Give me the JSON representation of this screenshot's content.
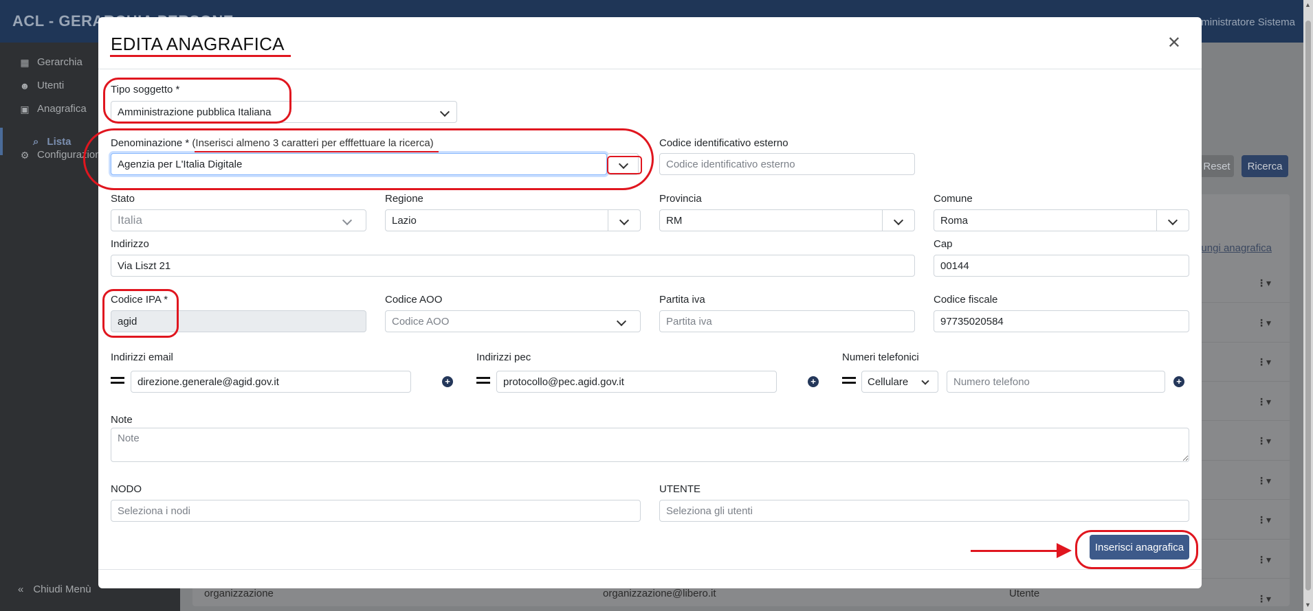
{
  "app": {
    "title": "ACL - GERARCHIA PERSONE",
    "user": "Amministratore Sistema"
  },
  "sidebar": {
    "items": [
      {
        "label": "Gerarchia",
        "icon": "sitemap-icon"
      },
      {
        "label": "Utenti",
        "icon": "users-icon"
      },
      {
        "label": "Anagrafica",
        "icon": "id-card-icon"
      },
      {
        "label": "Configurazioni",
        "icon": "gear-icon"
      }
    ],
    "sub_item": "Lista",
    "collapse": "Chiudi Menù"
  },
  "background": {
    "reset": "Reset",
    "ricerca": "Ricerca",
    "add_link": "Aggiungi anagrafica",
    "last_row": {
      "name": "organizzazione",
      "email": "organizzazione@libero.it",
      "role": "Utente"
    }
  },
  "modal": {
    "title": "EDITA ANAGRAFICA",
    "tipo_soggetto": {
      "label": "Tipo soggetto *",
      "value": "Amministrazione pubblica Italiana"
    },
    "denominazione": {
      "label": "Denominazione * ",
      "hint": "(Inserisci almeno 3 caratteri per efffettuare la ricerca)",
      "value": "Agenzia per L'Italia Digitale"
    },
    "codice_esterno": {
      "label": "Codice identificativo esterno",
      "placeholder": "Codice identificativo esterno"
    },
    "stato": {
      "label": "Stato",
      "value": "Italia"
    },
    "regione": {
      "label": "Regione",
      "value": "Lazio"
    },
    "provincia": {
      "label": "Provincia",
      "value": "RM"
    },
    "comune": {
      "label": "Comune",
      "value": "Roma"
    },
    "indirizzo": {
      "label": "Indirizzo",
      "value": "Via Liszt 21"
    },
    "cap": {
      "label": "Cap",
      "value": "00144"
    },
    "codice_ipa": {
      "label": "Codice IPA *",
      "value": "agid"
    },
    "codice_aoo": {
      "label": "Codice AOO",
      "placeholder": "Codice AOO"
    },
    "partita_iva": {
      "label": "Partita iva",
      "placeholder": "Partita iva"
    },
    "codice_fiscale": {
      "label": "Codice fiscale",
      "value": "97735020584"
    },
    "email": {
      "label": "Indirizzi email",
      "value": "direzione.generale@agid.gov.it"
    },
    "pec": {
      "label": "Indirizzi pec",
      "value": "protocollo@pec.agid.gov.it"
    },
    "telefoni": {
      "label": "Numeri telefonici",
      "type": "Cellulare",
      "placeholder": "Numero telefono"
    },
    "note": {
      "label": "Note",
      "placeholder": "Note"
    },
    "nodo": {
      "label": "NODO",
      "placeholder": "Seleziona i nodi"
    },
    "utente": {
      "label": "UTENTE",
      "placeholder": "Seleziona gli utenti"
    },
    "submit": "Inserisci anagrafica"
  },
  "colors": {
    "annotation": "#e0161f",
    "primary": "#3d5a8a",
    "header": "#1f3657"
  }
}
